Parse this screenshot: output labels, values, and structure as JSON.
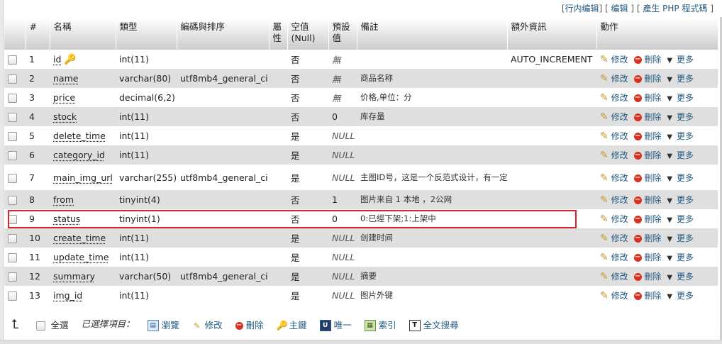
{
  "top_links": {
    "inline_edit": "行内编辑",
    "edit": "编辑",
    "create_php": "產生 PHP 程式碼"
  },
  "headers": {
    "num": "#",
    "name": "名稱",
    "type": "類型",
    "collation": "編碼與排序",
    "attributes": "屬性",
    "null": "空值 (Null)",
    "default": "預設值",
    "comments": "備註",
    "extra": "額外資訊",
    "action": "動作"
  },
  "actions": {
    "change": "修改",
    "drop": "刪除",
    "more": "更多"
  },
  "rows": [
    {
      "num": "1",
      "name": "id",
      "type": "int(11)",
      "collation": "",
      "nullable": "否",
      "default": "無",
      "default_italic": true,
      "comment": "",
      "extra": "AUTO_INCREMENT",
      "primary": true
    },
    {
      "num": "2",
      "name": "name",
      "type": "varchar(80)",
      "collation": "utf8mb4_general_ci",
      "nullable": "否",
      "default": "無",
      "default_italic": true,
      "comment": "商品名称",
      "extra": ""
    },
    {
      "num": "3",
      "name": "price",
      "type": "decimal(6,2)",
      "collation": "",
      "nullable": "否",
      "default": "無",
      "default_italic": true,
      "comment": "价格,单位：分",
      "extra": ""
    },
    {
      "num": "4",
      "name": "stock",
      "type": "int(11)",
      "collation": "",
      "nullable": "否",
      "default": "0",
      "default_italic": false,
      "comment": "库存量",
      "extra": ""
    },
    {
      "num": "5",
      "name": "delete_time",
      "type": "int(11)",
      "collation": "",
      "nullable": "是",
      "default": "NULL",
      "default_italic": true,
      "comment": "",
      "extra": ""
    },
    {
      "num": "6",
      "name": "category_id",
      "type": "int(11)",
      "collation": "",
      "nullable": "是",
      "default": "NULL",
      "default_italic": true,
      "comment": "",
      "extra": ""
    },
    {
      "num": "7",
      "name": "main_img_url",
      "type": "varchar(255)",
      "collation": "utf8mb4_general_ci",
      "nullable": "是",
      "default": "NULL",
      "default_italic": true,
      "comment": "主图ID号，这是一个反范式设计，有一定的冗余",
      "extra": "",
      "tall": true
    },
    {
      "num": "8",
      "name": "from",
      "type": "tinyint(4)",
      "collation": "",
      "nullable": "否",
      "default": "1",
      "default_italic": false,
      "comment": "图片来自 1 本地 ，2公网",
      "extra": ""
    },
    {
      "num": "9",
      "name": "status",
      "type": "tinyint(1)",
      "collation": "",
      "nullable": "否",
      "default": "0",
      "default_italic": false,
      "comment": "0:已經下架;1:上架中",
      "extra": "",
      "highlighted": true
    },
    {
      "num": "10",
      "name": "create_time",
      "type": "int(11)",
      "collation": "",
      "nullable": "是",
      "default": "NULL",
      "default_italic": true,
      "comment": "创建时间",
      "extra": ""
    },
    {
      "num": "11",
      "name": "update_time",
      "type": "int(11)",
      "collation": "",
      "nullable": "是",
      "default": "NULL",
      "default_italic": true,
      "comment": "",
      "extra": ""
    },
    {
      "num": "12",
      "name": "summary",
      "type": "varchar(50)",
      "collation": "utf8mb4_general_ci",
      "nullable": "是",
      "default": "NULL",
      "default_italic": true,
      "comment": "摘要",
      "extra": ""
    },
    {
      "num": "13",
      "name": "img_id",
      "type": "int(11)",
      "collation": "",
      "nullable": "是",
      "default": "NULL",
      "default_italic": true,
      "comment": "图片外键",
      "extra": ""
    }
  ],
  "bottom_bar": {
    "check_all": "全選",
    "with_selected": "已選擇項目：",
    "browse": "瀏覽",
    "change": "修改",
    "drop": "刪除",
    "primary": "主鍵",
    "unique": "唯一",
    "index": "索引",
    "fulltext": "全文搜尋"
  },
  "colors": {
    "accent_link": "#235a81",
    "highlight_border": "#d8242e",
    "row_even": "#dfdfdf"
  }
}
